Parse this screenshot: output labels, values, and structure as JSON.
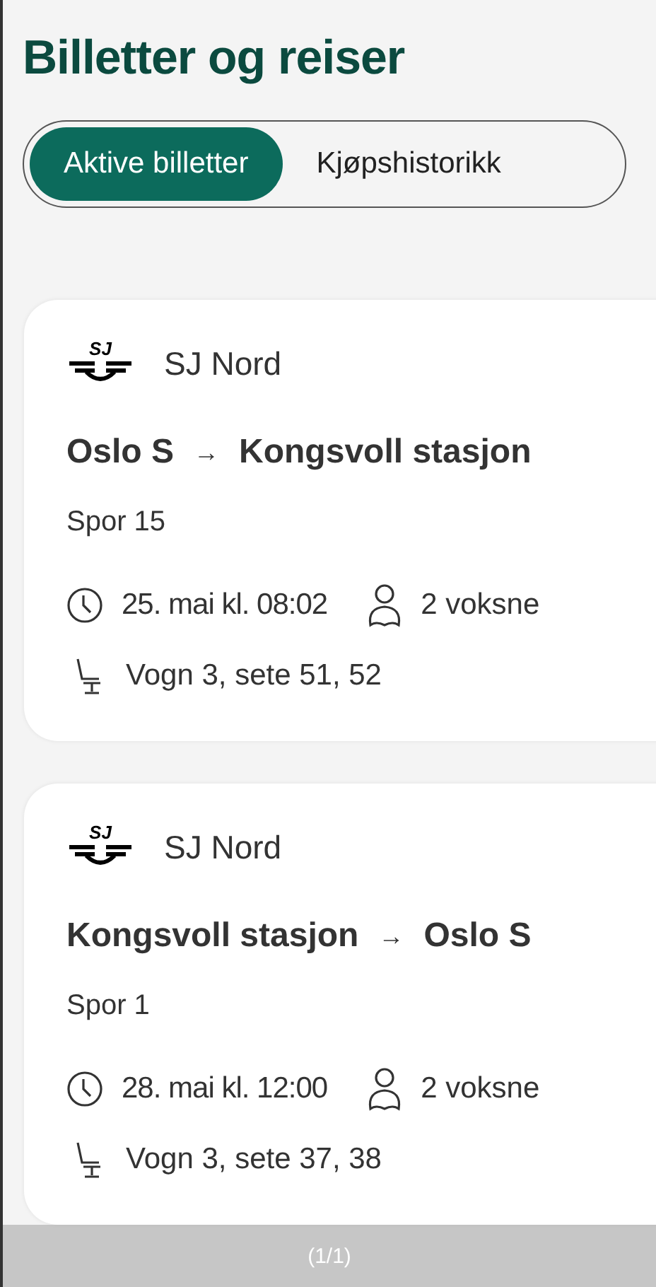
{
  "title": "Billetter og reiser",
  "tabs": [
    {
      "label": "Aktive billetter",
      "selected": true
    },
    {
      "label": "Kjøpshistorikk",
      "selected": false
    }
  ],
  "tickets": [
    {
      "logo_text": "SJ",
      "operator": "SJ Nord",
      "from": "Oslo S",
      "arrow": "→",
      "to": "Kongsvoll stasjon",
      "track": "Spor 15",
      "departure": "25. mai kl. 08:02",
      "travellers": "2 voksne",
      "seats": "Vogn 3, sete 51, 52"
    },
    {
      "logo_text": "SJ",
      "operator": "SJ Nord",
      "from": "Kongsvoll stasjon",
      "arrow": "→",
      "to": "Oslo S",
      "track": "Spor 1",
      "departure": "28. mai kl. 12:00",
      "travellers": "2 voksne",
      "seats": "Vogn 3, sete 37, 38"
    }
  ],
  "page_counter": "(1/1)"
}
